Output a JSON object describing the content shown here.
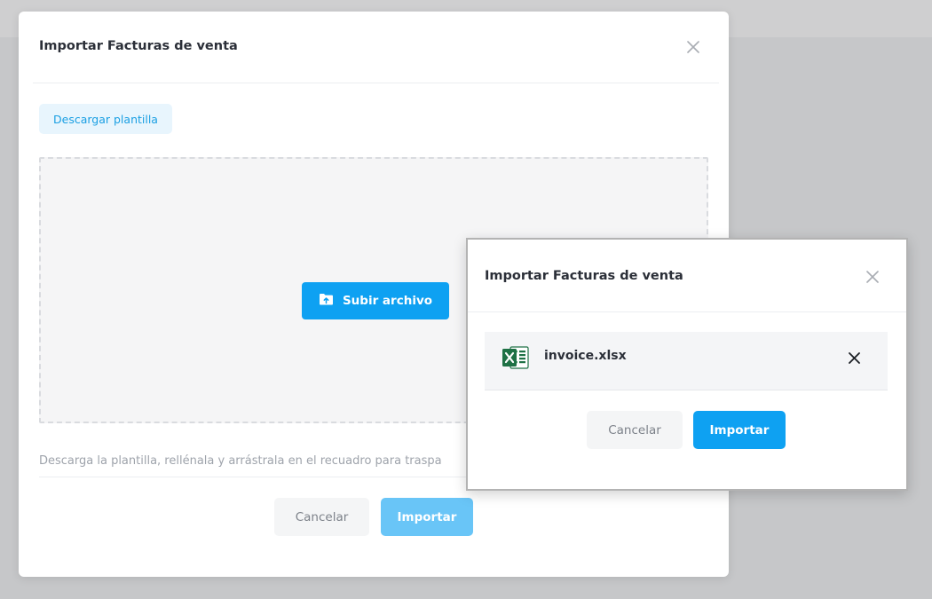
{
  "main_modal": {
    "title": "Importar Facturas de venta",
    "close_icon": "close-icon",
    "download_template_label": "Descargar plantilla",
    "upload_button_label": "Subir archivo",
    "upload_icon": "folder-upload-icon",
    "helper_text": "Descarga la plantilla, rellénala y arrástrala en el recuadro para traspa",
    "cancel_label": "Cancelar",
    "import_label": "Importar"
  },
  "result_modal": {
    "title": "Importar Facturas de venta",
    "close_icon": "close-icon",
    "file": {
      "name": "invoice.xlsx",
      "icon": "excel-file-icon",
      "remove_icon": "close-icon"
    },
    "cancel_label": "Cancelar",
    "import_label": "Importar"
  },
  "colors": {
    "primary": "#0ea1f2",
    "primary_disabled": "#69c5f7",
    "excel_green": "#1e7145"
  }
}
